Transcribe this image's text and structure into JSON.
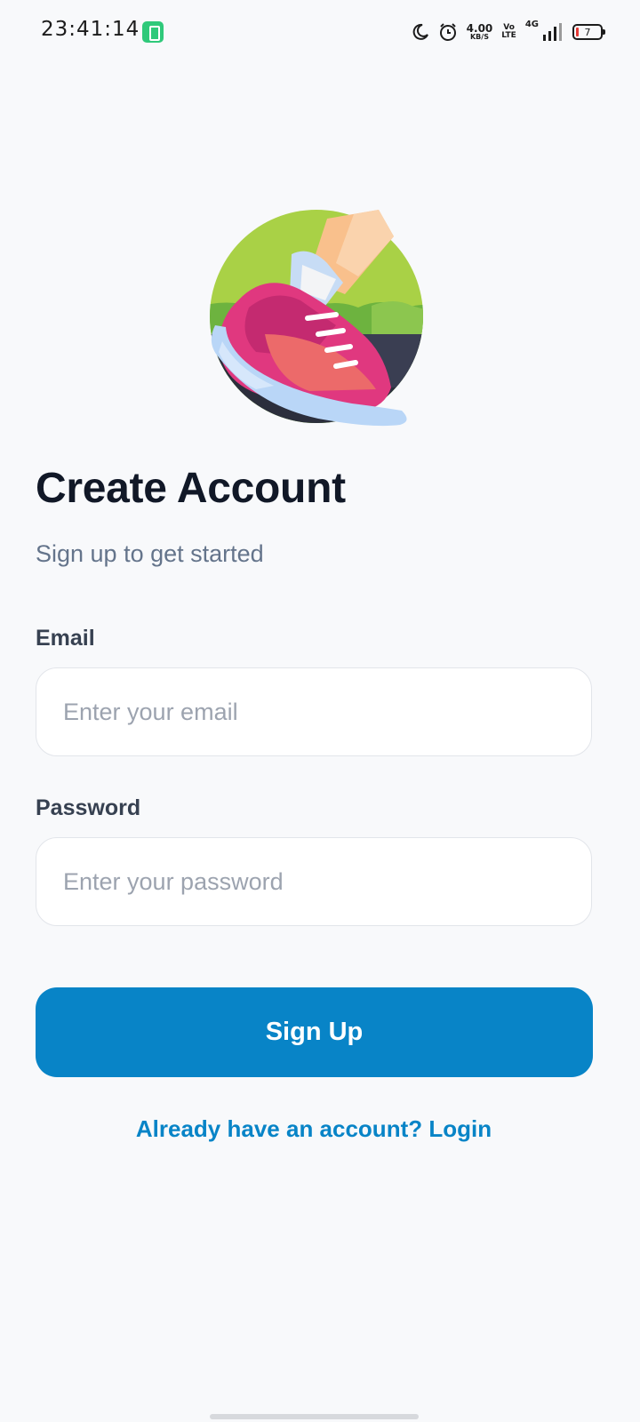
{
  "status_bar": {
    "time": "23:41:14",
    "speed_value": "4.00",
    "speed_unit": "KB/S",
    "volte_top": "Vo",
    "volte_bottom": "LTE",
    "network": "4G",
    "battery_level": "7",
    "icons": [
      "app-notification-icon",
      "moon-icon",
      "alarm-icon",
      "signal-icon",
      "battery-icon"
    ]
  },
  "hero": {
    "icon": "running-shoe-illustration"
  },
  "page": {
    "title": "Create Account",
    "subtitle": "Sign up to get started"
  },
  "form": {
    "email_label": "Email",
    "email_placeholder": "Enter your email",
    "email_value": "",
    "password_label": "Password",
    "password_placeholder": "Enter your password",
    "password_value": "",
    "submit_label": "Sign Up",
    "login_link": "Already have an account? Login"
  },
  "colors": {
    "primary": "#0884c7",
    "background": "#f8f9fb",
    "title": "#111827",
    "subtitle": "#64748b"
  }
}
